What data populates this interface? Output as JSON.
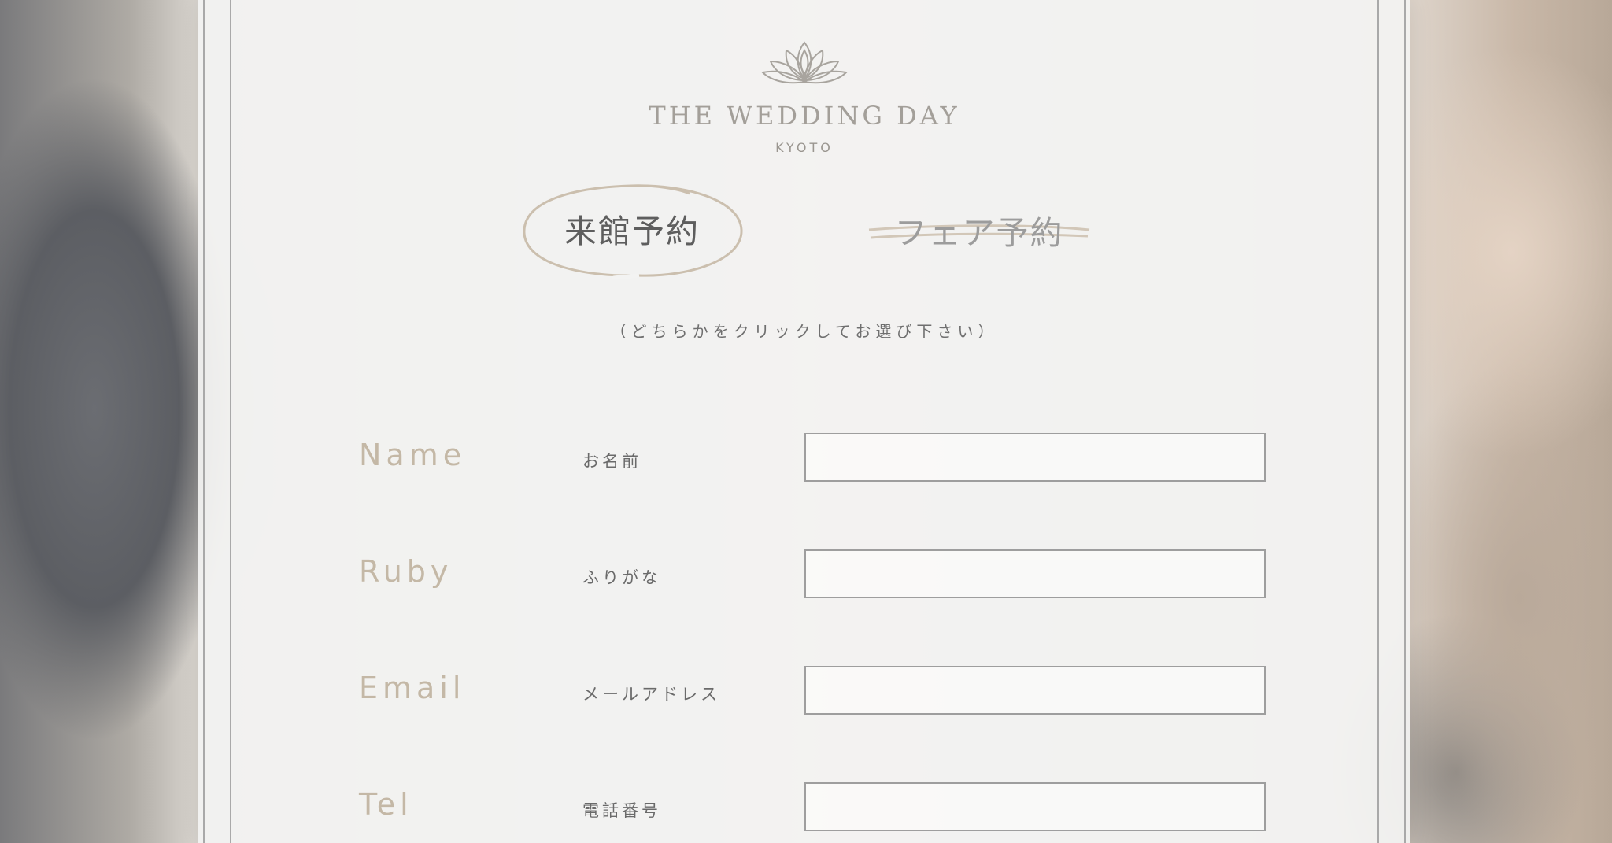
{
  "brand": {
    "title": "THE WEDDING DAY",
    "subtitle": "KYOTO",
    "logo_icon": "lotus-icon"
  },
  "tabs": [
    {
      "label": "来館予約",
      "state": "selected"
    },
    {
      "label": "フェア予約",
      "state": "unselected"
    }
  ],
  "hint": "（どちらかをクリックしてお選び下さい）",
  "form": {
    "fields": [
      {
        "label_en": "Name",
        "label_ja": "お名前",
        "value": ""
      },
      {
        "label_en": "Ruby",
        "label_ja": "ふりがな",
        "value": ""
      },
      {
        "label_en": "Email",
        "label_ja": "メールアドレス",
        "value": ""
      },
      {
        "label_en": "Tel",
        "label_ja": "電話番号",
        "value": ""
      }
    ]
  },
  "colors": {
    "accent_gold": "#c4b8a6",
    "text_dark": "#5e5e5e",
    "frame": "#a9a9a9"
  }
}
